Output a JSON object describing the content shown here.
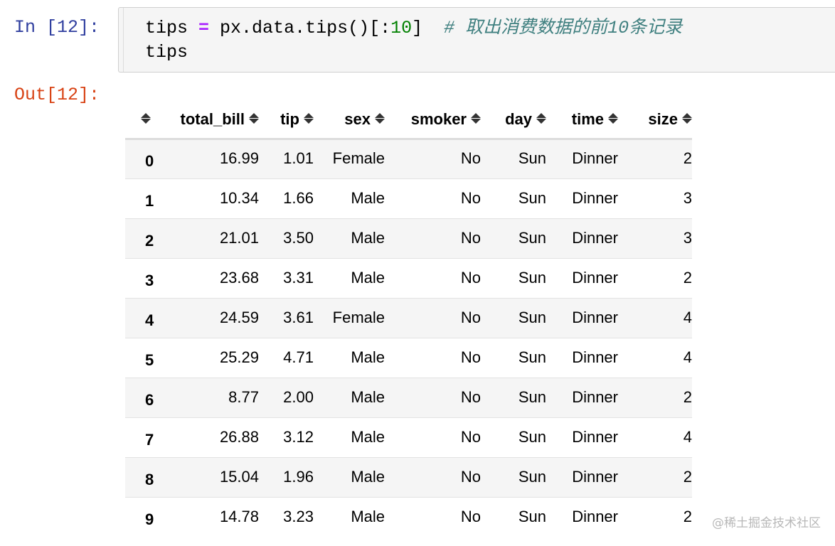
{
  "input_prompt": "In [12]:",
  "output_prompt": "Out[12]:",
  "code": {
    "line1": {
      "var": "tips",
      "op": "=",
      "call": " px.data.tips()[:",
      "num": "10",
      "close": "]",
      "comment": "# 取出消费数据的前10条记录"
    },
    "line2": "tips"
  },
  "table": {
    "columns": [
      "total_bill",
      "tip",
      "sex",
      "smoker",
      "day",
      "time",
      "size"
    ],
    "rows": [
      [
        "0",
        "16.99",
        "1.01",
        "Female",
        "No",
        "Sun",
        "Dinner",
        "2"
      ],
      [
        "1",
        "10.34",
        "1.66",
        "Male",
        "No",
        "Sun",
        "Dinner",
        "3"
      ],
      [
        "2",
        "21.01",
        "3.50",
        "Male",
        "No",
        "Sun",
        "Dinner",
        "3"
      ],
      [
        "3",
        "23.68",
        "3.31",
        "Male",
        "No",
        "Sun",
        "Dinner",
        "2"
      ],
      [
        "4",
        "24.59",
        "3.61",
        "Female",
        "No",
        "Sun",
        "Dinner",
        "4"
      ],
      [
        "5",
        "25.29",
        "4.71",
        "Male",
        "No",
        "Sun",
        "Dinner",
        "4"
      ],
      [
        "6",
        "8.77",
        "2.00",
        "Male",
        "No",
        "Sun",
        "Dinner",
        "2"
      ],
      [
        "7",
        "26.88",
        "3.12",
        "Male",
        "No",
        "Sun",
        "Dinner",
        "4"
      ],
      [
        "8",
        "15.04",
        "1.96",
        "Male",
        "No",
        "Sun",
        "Dinner",
        "2"
      ],
      [
        "9",
        "14.78",
        "3.23",
        "Male",
        "No",
        "Sun",
        "Dinner",
        "2"
      ]
    ]
  },
  "watermark": "@稀土掘金技术社区",
  "colors": {
    "input_prompt": "#303f9f",
    "output_prompt": "#d84315",
    "operator": "#aa22ff",
    "number": "#008000",
    "comment": "#408080"
  },
  "icons": {
    "sort": "sort-updown-icon"
  }
}
